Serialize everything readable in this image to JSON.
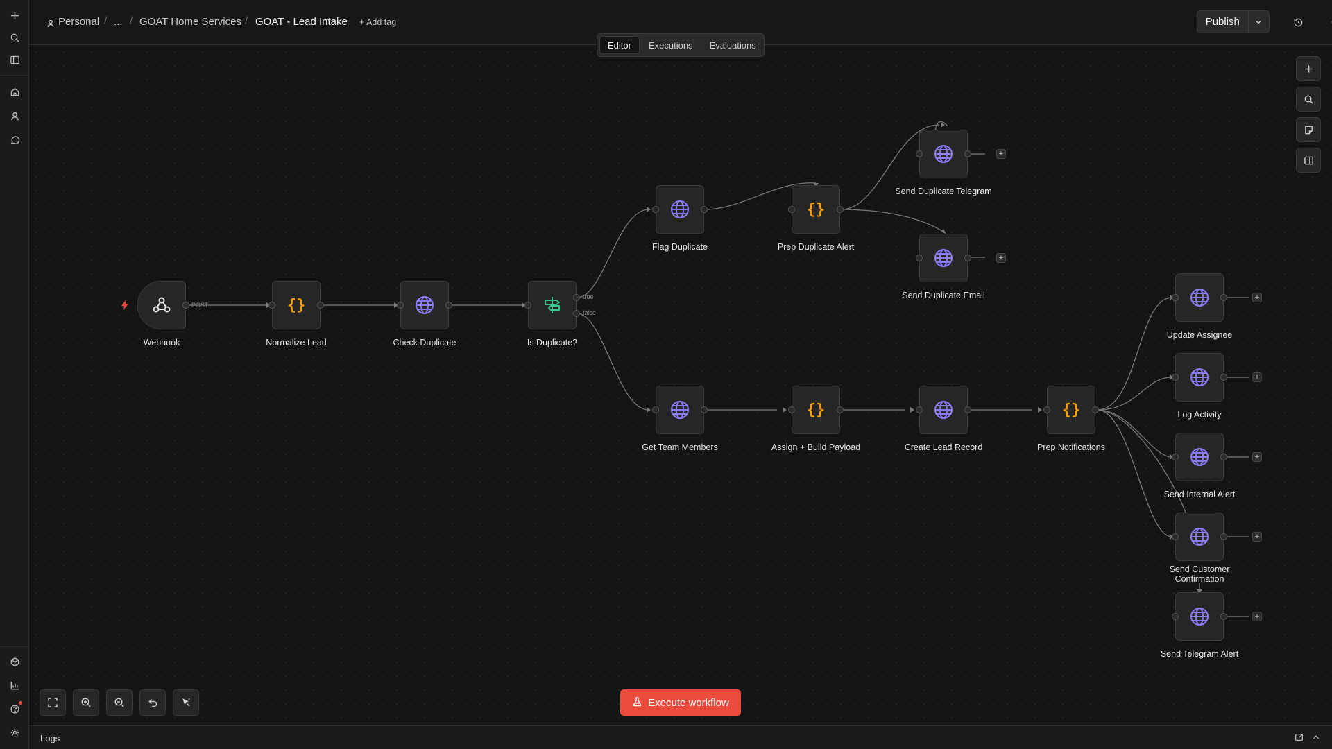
{
  "colors": {
    "accent": "#ea4b3c",
    "http_icon": "#8b7cf6",
    "code_icon": "#f59e0b",
    "if_icon": "#36c48f",
    "canvas_bg": "#141414"
  },
  "breadcrumb": {
    "owner": "Personal",
    "ellipsis": "...",
    "folder": "GOAT Home Services",
    "workflow": "GOAT - Lead Intake",
    "add_tag": "+ Add tag"
  },
  "header": {
    "publish_label": "Publish"
  },
  "tabs": [
    {
      "label": "Editor",
      "active": true
    },
    {
      "label": "Executions",
      "active": false
    },
    {
      "label": "Evaluations",
      "active": false
    }
  ],
  "nodes": {
    "webhook": {
      "label": "Webhook",
      "icon": "webhook-icon"
    },
    "normalize_lead": {
      "label": "Normalize Lead",
      "icon": "code-braces-icon"
    },
    "check_duplicate": {
      "label": "Check Duplicate",
      "icon": "globe-icon"
    },
    "is_duplicate": {
      "label": "Is Duplicate?",
      "icon": "signpost-icon"
    },
    "flag_duplicate": {
      "label": "Flag Duplicate",
      "icon": "globe-icon"
    },
    "prep_duplicate_alert": {
      "label": "Prep Duplicate Alert",
      "icon": "code-braces-icon"
    },
    "send_duplicate_telegram": {
      "label": "Send Duplicate Telegram",
      "icon": "globe-icon"
    },
    "send_duplicate_email": {
      "label": "Send Duplicate Email",
      "icon": "globe-icon"
    },
    "get_team_members": {
      "label": "Get Team Members",
      "icon": "globe-icon"
    },
    "assign_build_payload": {
      "label": "Assign + Build Payload",
      "icon": "code-braces-icon"
    },
    "create_lead_record": {
      "label": "Create Lead Record",
      "icon": "globe-icon"
    },
    "prep_notifications": {
      "label": "Prep Notifications",
      "icon": "code-braces-icon"
    },
    "update_assignee": {
      "label": "Update Assignee",
      "icon": "globe-icon"
    },
    "log_activity": {
      "label": "Log Activity",
      "icon": "globe-icon"
    },
    "send_internal_alert": {
      "label": "Send Internal Alert",
      "icon": "globe-icon"
    },
    "send_customer_confirmation": {
      "label": "Send Customer Confirmation",
      "icon": "globe-icon"
    },
    "send_telegram_alert": {
      "label": "Send Telegram Alert",
      "icon": "globe-icon"
    }
  },
  "edge_labels": {
    "webhook_method": "POST",
    "if_true": "true",
    "if_false": "false"
  },
  "actions": {
    "execute_workflow": "Execute workflow"
  },
  "logs": {
    "label": "Logs"
  }
}
